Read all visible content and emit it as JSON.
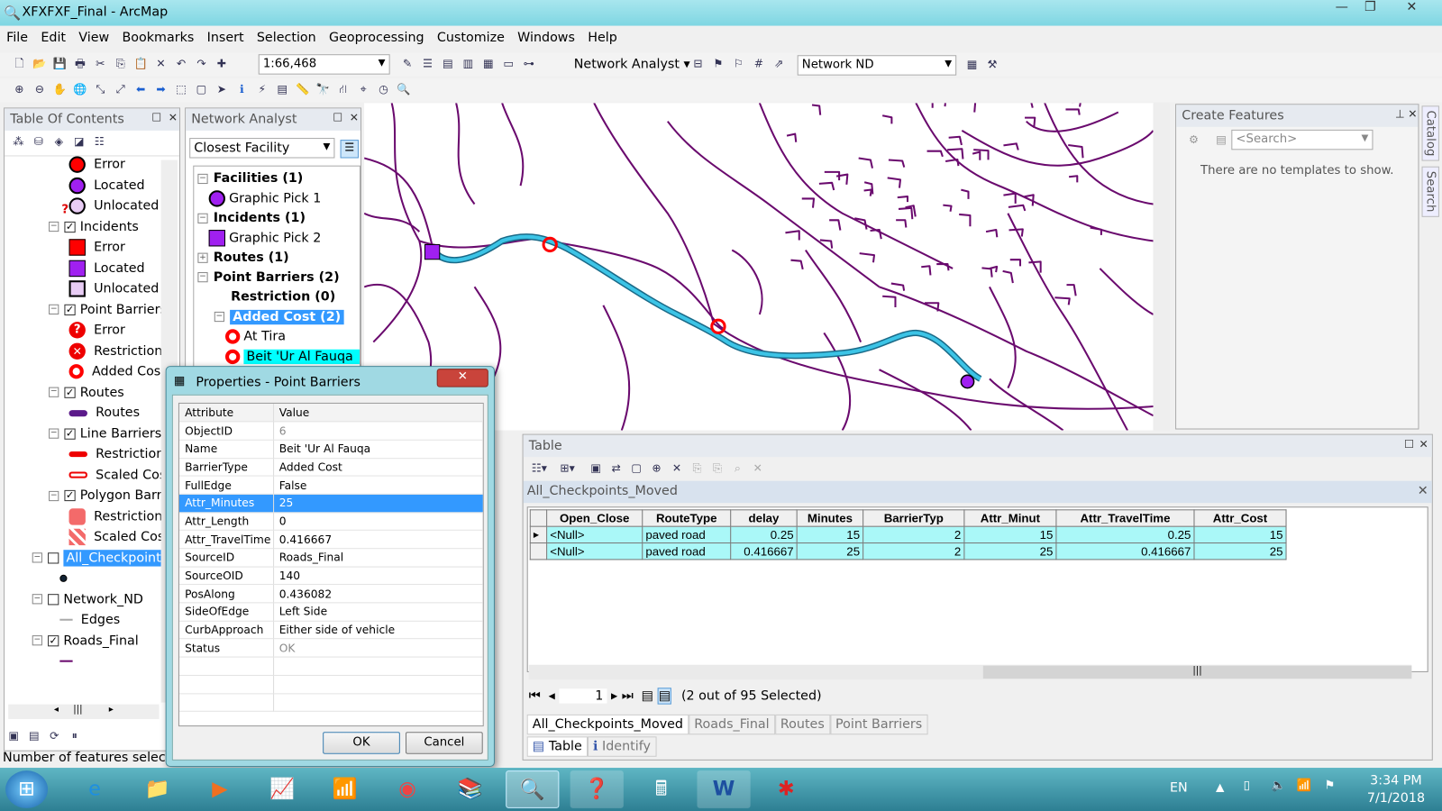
{
  "window": {
    "title": "XFXFXF_Final - ArcMap"
  },
  "menu": [
    "File",
    "Edit",
    "View",
    "Bookmarks",
    "Insert",
    "Selection",
    "Geoprocessing",
    "Customize",
    "Windows",
    "Help"
  ],
  "toolbar": {
    "scale": "1:66,468",
    "network_analyst_label": "Network Analyst",
    "network_dataset": "Network ND"
  },
  "toc": {
    "title": "Table Of Contents",
    "items": [
      {
        "label": "Error",
        "sym": "circle-red",
        "indent": 3
      },
      {
        "label": "Located",
        "sym": "circle-purple",
        "indent": 3
      },
      {
        "label": "Unlocated",
        "sym": "circle-unlocated",
        "indent": 3
      },
      {
        "label": "Incidents",
        "sym": "group",
        "indent": 2,
        "checked": true
      },
      {
        "label": "Error",
        "sym": "square-red",
        "indent": 3
      },
      {
        "label": "Located",
        "sym": "square-purple",
        "indent": 3
      },
      {
        "label": "Unlocated",
        "sym": "square-unlocated",
        "indent": 3
      },
      {
        "label": "Point Barriers",
        "sym": "group",
        "indent": 2,
        "checked": true
      },
      {
        "label": "Error",
        "sym": "barrier-error",
        "indent": 3
      },
      {
        "label": "Restriction",
        "sym": "barrier-restriction",
        "indent": 3
      },
      {
        "label": "Added Cos",
        "sym": "ring-red",
        "indent": 3
      },
      {
        "label": "Routes",
        "sym": "group",
        "indent": 2,
        "checked": true
      },
      {
        "label": "Routes",
        "sym": "line-purple",
        "indent": 3
      },
      {
        "label": "Line Barriers",
        "sym": "group",
        "indent": 2,
        "checked": true
      },
      {
        "label": "Restriction",
        "sym": "line-red",
        "indent": 3
      },
      {
        "label": "Scaled Cos",
        "sym": "line-red-hollow",
        "indent": 3
      },
      {
        "label": "Polygon Barr",
        "sym": "group",
        "indent": 2,
        "checked": true
      },
      {
        "label": "Restriction",
        "sym": "poly-red",
        "indent": 3
      },
      {
        "label": "Scaled Cos",
        "sym": "poly-scaled",
        "indent": 3
      },
      {
        "label": "All_Checkpoints",
        "sym": "group",
        "indent": 1,
        "checked": false,
        "selected": true
      },
      {
        "label": "",
        "sym": "dot-dark",
        "indent": 2
      },
      {
        "label": "Network_ND",
        "sym": "group",
        "indent": 1,
        "checked": false
      },
      {
        "label": "Edges",
        "sym": "line-grey",
        "indent": 2
      },
      {
        "label": "Roads_Final",
        "sym": "group",
        "indent": 1,
        "checked": true
      },
      {
        "label": "",
        "sym": "line-purple-thin",
        "indent": 2
      }
    ]
  },
  "network_analyst": {
    "title": "Network Analyst",
    "analysis": "Closest Facility",
    "tree": [
      {
        "label": "Facilities (1)",
        "bold": true,
        "expander": "-",
        "level": 0
      },
      {
        "label": "Graphic Pick 1",
        "sym": "circle-purple",
        "level": 1
      },
      {
        "label": "Incidents (1)",
        "bold": true,
        "expander": "-",
        "level": 0
      },
      {
        "label": "Graphic Pick 2",
        "sym": "square-purple",
        "level": 1
      },
      {
        "label": "Routes (1)",
        "bold": true,
        "expander": "+",
        "level": 0
      },
      {
        "label": "Point Barriers (2)",
        "bold": true,
        "expander": "-",
        "level": 0
      },
      {
        "label": "Restriction (0)",
        "bold": true,
        "level": 2
      },
      {
        "label": "Added Cost (2)",
        "bold": true,
        "expander": "-",
        "level": 1,
        "selected": true
      },
      {
        "label": "At Tira",
        "sym": "ring-red",
        "level": 2
      },
      {
        "label": "Beit 'Ur Al Fauqa",
        "sym": "ring-red",
        "level": 2,
        "highlight": true
      }
    ]
  },
  "properties": {
    "title": "Properties - Point Barriers",
    "col_attribute": "Attribute",
    "col_value": "Value",
    "rows": [
      [
        "ObjectID",
        "6"
      ],
      [
        "Name",
        "Beit 'Ur Al Fauqa"
      ],
      [
        "BarrierType",
        "Added Cost"
      ],
      [
        "FullEdge",
        "False"
      ],
      [
        "Attr_Minutes",
        "25"
      ],
      [
        "Attr_Length",
        "0"
      ],
      [
        "Attr_TravelTime",
        "0.416667"
      ],
      [
        "SourceID",
        "Roads_Final"
      ],
      [
        "SourceOID",
        "140"
      ],
      [
        "PosAlong",
        "0.436082"
      ],
      [
        "SideOfEdge",
        "Left Side"
      ],
      [
        "CurbApproach",
        "Either side of vehicle"
      ],
      [
        "Status",
        "OK"
      ]
    ],
    "selected_row": 4,
    "ok": "OK",
    "cancel": "Cancel"
  },
  "create_features": {
    "title": "Create Features",
    "search_placeholder": "<Search>",
    "empty": "There are no templates to show."
  },
  "side_tabs": [
    "Catalog",
    "Search"
  ],
  "table": {
    "title": "Table",
    "layer": "All_Checkpoints_Moved",
    "columns": [
      "Open_Close",
      "RouteType",
      "delay",
      "Minutes",
      "BarrierTyp",
      "Attr_Minut",
      "Attr_TravelTime",
      "Attr_Cost"
    ],
    "rows": [
      [
        "<Null>",
        "paved road",
        "0.25",
        "15",
        "2",
        "15",
        "0.25",
        "15"
      ],
      [
        "<Null>",
        "paved road",
        "0.416667",
        "25",
        "2",
        "25",
        "0.416667",
        "25"
      ]
    ],
    "page": "1",
    "selection": "(2 out of 95 Selected)",
    "layer_tabs": [
      "All_Checkpoints_Moved",
      "Roads_Final",
      "Routes",
      "Point Barriers"
    ],
    "bottom_tabs": [
      "Table",
      "Identify"
    ]
  },
  "status": {
    "text": "Number of features selecte"
  },
  "taskbar": {
    "lang": "EN",
    "time": "3:34 PM",
    "date": "7/1/2018"
  },
  "colors": {
    "road": "#6a0a6e",
    "route": "#3cc4e6",
    "barrier": "#ff0000",
    "facility": "#a020f0",
    "selection": "#3399ff",
    "highlight": "#00ffff"
  }
}
